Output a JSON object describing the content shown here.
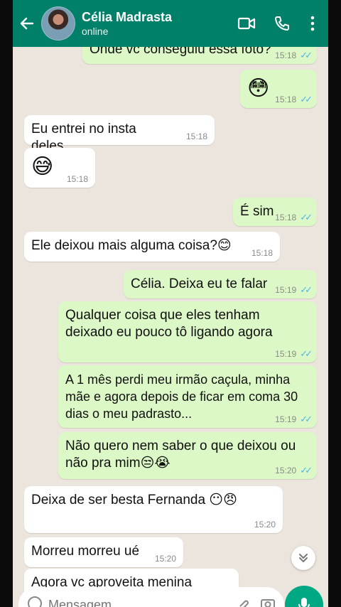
{
  "header": {
    "contact_name": "Célia Madrasta",
    "status": "online"
  },
  "messages": [
    {
      "dir": "out",
      "text": "Onde vc conseguiu essa foto?",
      "time": "15:18",
      "ticks": "✓✓"
    },
    {
      "dir": "out",
      "text": "😳",
      "time": "15:18",
      "ticks": "✓✓"
    },
    {
      "dir": "in",
      "text": "Eu entrei no insta deles",
      "time": "15:18"
    },
    {
      "dir": "in",
      "text": "😅",
      "time": "15:18"
    },
    {
      "dir": "out",
      "text": "É sim",
      "time": "15:18",
      "ticks": "✓✓"
    },
    {
      "dir": "in",
      "text": "Ele deixou mais alguma coisa?😊",
      "time": "15:18"
    },
    {
      "dir": "out",
      "text": "Célia. Deixa eu te falar",
      "time": "15:19",
      "ticks": "✓✓"
    },
    {
      "dir": "out",
      "text": "Qualquer coisa que eles tenham deixado eu pouco tô ligando agora",
      "time": "15:19",
      "ticks": "✓✓"
    },
    {
      "dir": "out",
      "text": "A 1 mês perdi meu irmão caçula, minha mãe e agora depois de ficar em coma 30 dias o meu padrasto...",
      "time": "15:19",
      "ticks": "✓✓"
    },
    {
      "dir": "out",
      "text": "Não quero nem saber o que deixou ou não pra mim😒😭",
      "time": "15:20",
      "ticks": "✓✓"
    },
    {
      "dir": "in",
      "text": "Deixa de ser besta Fernanda 😶😠",
      "time": "15:20"
    },
    {
      "dir": "in",
      "text": "Morreu morreu ué",
      "time": "15:20"
    },
    {
      "dir": "in",
      "text": "Agora vc aproveita menina",
      "time": ""
    }
  ],
  "input": {
    "placeholder": "Mensagem"
  },
  "colors": {
    "header": "#008069",
    "outgoing_bubble": "#dcf8c6",
    "incoming_bubble": "#ffffff",
    "read_tick": "#4fb6ec",
    "chat_bg": "#ece5dd"
  }
}
